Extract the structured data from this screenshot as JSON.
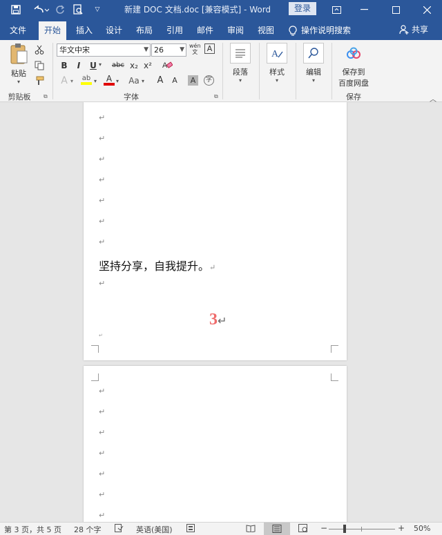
{
  "titlebar": {
    "document_title": "新建 DOC 文档.doc [兼容模式] - Word",
    "login_label": "登录",
    "quick_access": [
      "save-icon",
      "undo-icon",
      "redo-icon",
      "print-preview-icon",
      "customize-icon"
    ]
  },
  "tabs": [
    {
      "label": "文件",
      "active": false
    },
    {
      "label": "开始",
      "active": true
    },
    {
      "label": "插入",
      "active": false
    },
    {
      "label": "设计",
      "active": false
    },
    {
      "label": "布局",
      "active": false
    },
    {
      "label": "引用",
      "active": false
    },
    {
      "label": "邮件",
      "active": false
    },
    {
      "label": "审阅",
      "active": false
    },
    {
      "label": "视图",
      "active": false
    }
  ],
  "tell_me": "操作说明搜索",
  "share_label": "共享",
  "ribbon": {
    "clipboard": {
      "paste_label": "粘贴",
      "group_label": "剪贴板"
    },
    "font": {
      "font_name": "华文中宋",
      "font_size": "26",
      "wen_label": "wén\n文",
      "group_label": "字体",
      "bold": "B",
      "italic": "I",
      "underline": "U",
      "strike": "abc",
      "subscript": "x₂",
      "superscript": "x²",
      "case": "Aa",
      "grow": "A",
      "shrink": "A",
      "char_shade": "A",
      "char_border": "A"
    },
    "paragraph": {
      "label": "段落"
    },
    "styles": {
      "label": "样式"
    },
    "editing": {
      "label": "编辑"
    },
    "save": {
      "label_line1": "保存到",
      "label_line2": "百度网盘",
      "group_label": "保存"
    }
  },
  "document": {
    "page1_text": "坚持分享，自我提升。",
    "page_number": "3",
    "para_mark": "↵"
  },
  "statusbar": {
    "page_info": "第 3 页，共 5 页",
    "word_count": "28 个字",
    "language": "英语(美国)",
    "zoom": "50%",
    "zoom_minus": "−",
    "zoom_plus": "+"
  },
  "colors": {
    "brand": "#2b579a",
    "page_number": "#ef6a6a",
    "highlight": "#ffff00",
    "font_color": "#e00000"
  }
}
